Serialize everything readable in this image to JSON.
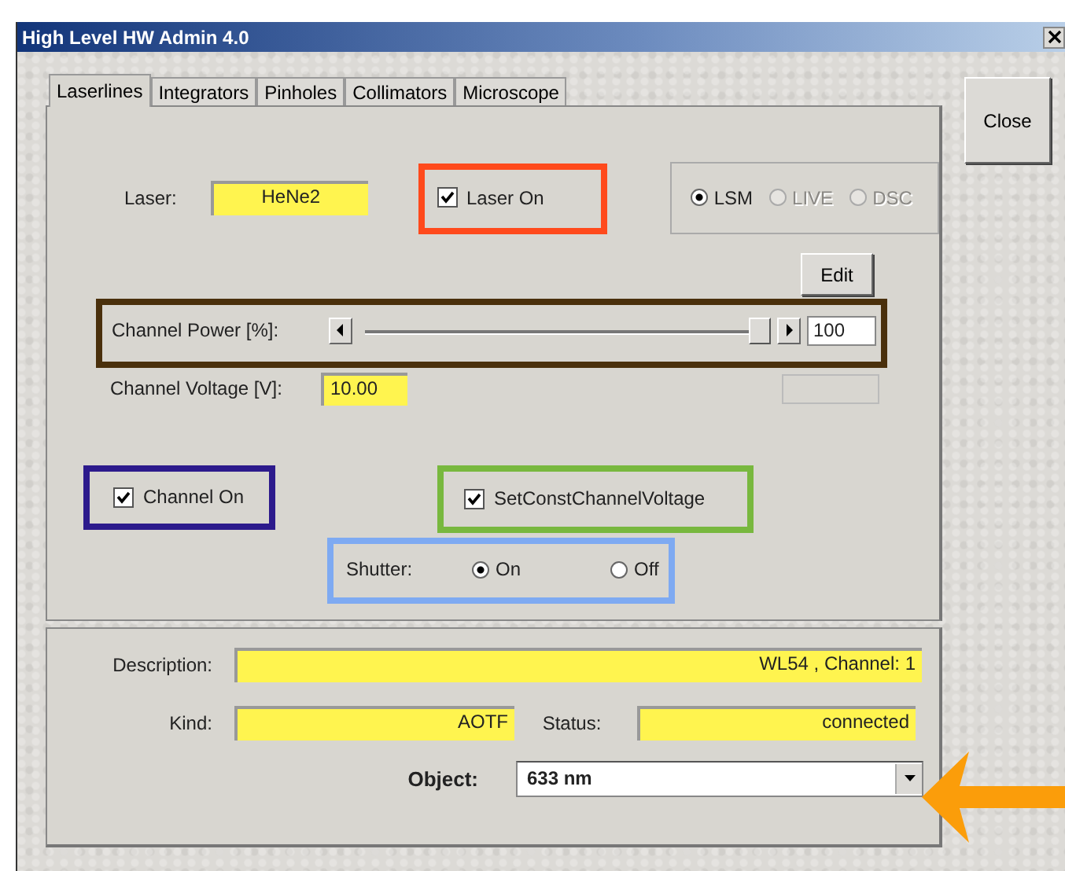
{
  "window": {
    "title": "High Level HW Admin 4.0"
  },
  "tabs": [
    {
      "label": "Laserlines",
      "selected": true
    },
    {
      "label": "Integrators",
      "selected": false
    },
    {
      "label": "Pinholes",
      "selected": false
    },
    {
      "label": "Collimators",
      "selected": false
    },
    {
      "label": "Microscope",
      "selected": false
    }
  ],
  "close_button": "Close",
  "laser": {
    "label": "Laser:",
    "value": "HeNe2"
  },
  "laser_on": {
    "label": "Laser On",
    "checked": true,
    "color": "#ff4a1c"
  },
  "mode_options": [
    {
      "label": "LSM",
      "selected": true,
      "disabled": false
    },
    {
      "label": "LIVE",
      "selected": false,
      "disabled": true
    },
    {
      "label": "DSC",
      "selected": false,
      "disabled": true
    }
  ],
  "edit_button": "Edit",
  "channel_power": {
    "label": "Channel Power [%]:",
    "level": 1,
    "value": "100",
    "color": "#4a300c"
  },
  "channel_voltage": {
    "label": "Channel Voltage [V]:",
    "value": "10.00"
  },
  "channel_on": {
    "label": "Channel On",
    "checked": true,
    "color": "#2c1a8c"
  },
  "set_const": {
    "label": "SetConstChannelVoltage",
    "checked": true,
    "color": "#78b83e"
  },
  "shutter": {
    "label": "Shutter:",
    "color": "#7eaaf2",
    "options": [
      {
        "label": "On",
        "selected": true
      },
      {
        "label": "Off",
        "selected": false
      }
    ]
  },
  "description": {
    "label": "Description:",
    "value": "WL54 , Channel: 1"
  },
  "kind": {
    "label": "Kind:",
    "value": "AOTF"
  },
  "status": {
    "label": "Status:",
    "value": "connected"
  },
  "object": {
    "label": "Object:",
    "value": "633 nm"
  }
}
